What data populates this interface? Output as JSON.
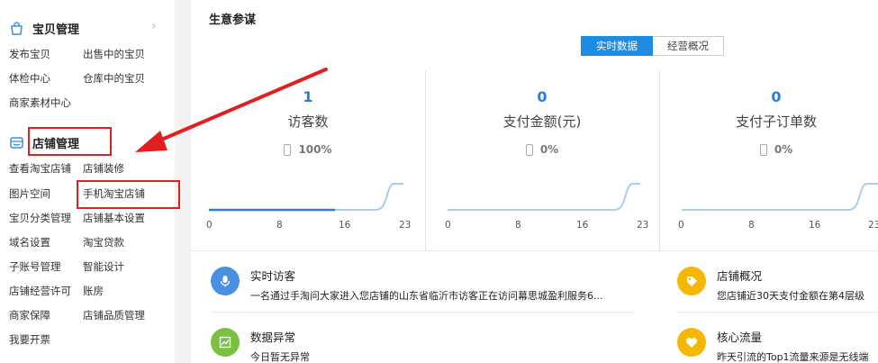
{
  "sidebar": {
    "goods": {
      "title": "宝贝管理",
      "links": [
        "发布宝贝",
        "出售中的宝贝",
        "体检中心",
        "仓库中的宝贝",
        "商家素材中心"
      ]
    },
    "shop": {
      "title": "店铺管理",
      "links": [
        "查看淘宝店铺",
        "店铺装修",
        "图片空间",
        "手机淘宝店铺",
        "宝贝分类管理",
        "店铺基本设置",
        "域名设置",
        "淘宝贷款",
        "子账号管理",
        "智能设计",
        "店铺经营许可",
        "账房",
        "商家保障",
        "店铺品质管理",
        "我要开票"
      ]
    },
    "chevron": "›"
  },
  "main": {
    "title": "生意参谋",
    "tabs": [
      "实时数据",
      "经营概况"
    ],
    "stats": [
      {
        "value": "1",
        "label": "访客数",
        "pct": "100%"
      },
      {
        "value": "0",
        "label": "支付金额(元)",
        "pct": "0%"
      },
      {
        "value": "0",
        "label": "支付子订单数",
        "pct": "0%"
      }
    ],
    "ticks": [
      "0",
      "8",
      "16",
      "23"
    ],
    "info": [
      {
        "title": "实时访客",
        "desc": "一名通过手淘问大家进入您店铺的山东省临沂市访客正在访问幕思城盈利服务6...",
        "icon": "microphone-icon",
        "color": "#4a90e2"
      },
      {
        "title": "店铺概况",
        "desc": "您店铺近30天支付金额在第4层级",
        "icon": "tag-icon",
        "color": "#f5b700"
      },
      {
        "title": "数据异常",
        "desc": "今日暂无异常",
        "icon": "chart-icon",
        "color": "#7ac143"
      },
      {
        "title": "核心流量",
        "desc": "昨天引流的Top1流量来源是无线端",
        "icon": "heart-icon",
        "color": "#f5b700"
      }
    ]
  },
  "colors": {
    "accent": "#1f8ce3",
    "annotation": "#e02020"
  }
}
